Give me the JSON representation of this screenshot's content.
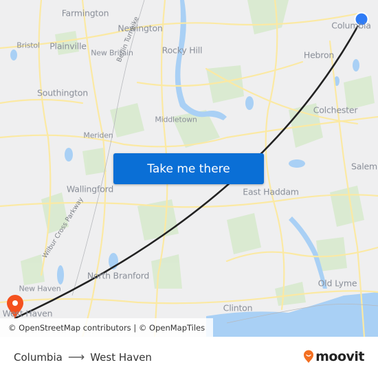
{
  "map": {
    "places": [
      {
        "name": "Farmington",
        "size": "normal"
      },
      {
        "name": "Newington",
        "size": "normal"
      },
      {
        "name": "Bristol",
        "size": "small"
      },
      {
        "name": "Plainville",
        "size": "normal"
      },
      {
        "name": "New Britain",
        "size": "small"
      },
      {
        "name": "Rocky Hill",
        "size": "normal"
      },
      {
        "name": "Columbia",
        "size": "normal"
      },
      {
        "name": "Hebron",
        "size": "normal"
      },
      {
        "name": "Southington",
        "size": "normal"
      },
      {
        "name": "Colchester",
        "size": "normal"
      },
      {
        "name": "Middletown",
        "size": "small"
      },
      {
        "name": "Meriden",
        "size": "small"
      },
      {
        "name": "Salem",
        "size": "normal"
      },
      {
        "name": "Wallingford",
        "size": "normal"
      },
      {
        "name": "East Haddam",
        "size": "normal"
      },
      {
        "name": "North Branford",
        "size": "normal"
      },
      {
        "name": "New Haven",
        "size": "small"
      },
      {
        "name": "Old Lyme",
        "size": "normal"
      },
      {
        "name": "West Haven",
        "size": "normal"
      },
      {
        "name": "Clinton",
        "size": "normal"
      }
    ],
    "roads": [
      "Berlin Turnpike",
      "Wilbur Cross Parkway"
    ],
    "origin_marker": {
      "label": "Columbia",
      "icon": "origin-dot-icon",
      "color": "#2f7cf6"
    },
    "destination_marker": {
      "label": "West Haven",
      "icon": "destination-pin-icon",
      "color": "#f4511e"
    },
    "route_color": "#222222"
  },
  "cta": {
    "label": "Take me there",
    "color": "#0a6fd6"
  },
  "attribution": "© OpenStreetMap contributors | © OpenMapTiles",
  "footer": {
    "origin": "Columbia",
    "arrow_icon": "arrow-right-icon",
    "destination": "West Haven",
    "brand": "moovit",
    "brand_color": "#f36f21"
  }
}
